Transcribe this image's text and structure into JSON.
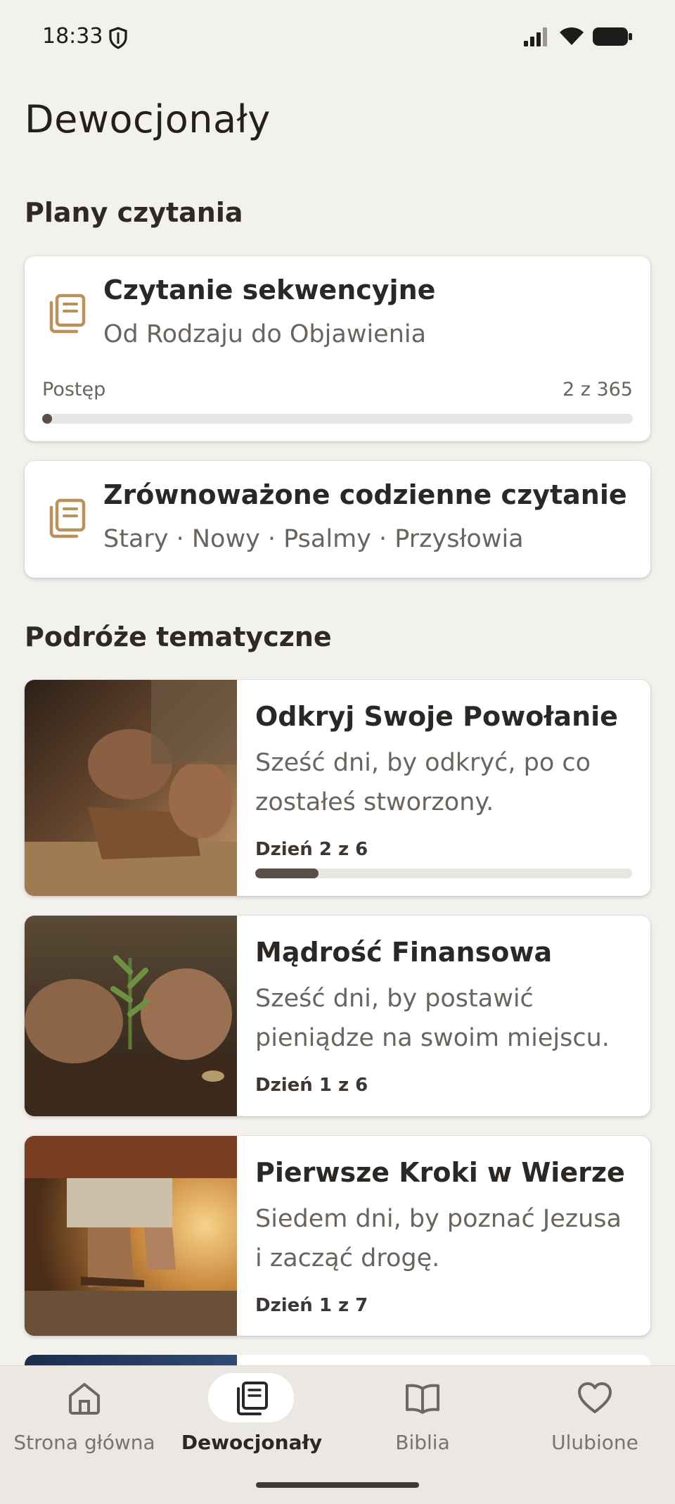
{
  "status_bar": {
    "time": "18:33"
  },
  "page_title": "Dewocjonały",
  "reading_plans": {
    "heading": "Plany czytania",
    "items": [
      {
        "title": "Czytanie sekwencyjne",
        "subtitle": "Od Rodzaju do Objawienia",
        "progress_label": "Postęp",
        "progress_count": "2 z 365",
        "progress_fraction": 0.0055,
        "icon": "books-icon"
      },
      {
        "title": "Zrównoważone codzienne czytanie",
        "subtitle": "Stary · Nowy · Psalmy · Przysłowia",
        "icon": "books-icon"
      }
    ]
  },
  "journeys": {
    "heading": "Podróże tematyczne",
    "items": [
      {
        "title": "Odkryj Swoje Powołanie",
        "description": "Sześć dni, by odkryć, po co zostałeś stworzony.",
        "day": "Dzień 2 z 6",
        "progress_fraction": 0.167,
        "image": "hands-carving-wood"
      },
      {
        "title": "Mądrość Finansowa",
        "description": "Sześć dni, by postawić pieniądze na swoim miejscu.",
        "day": "Dzień 1 z 6",
        "image": "hands-planting-seedling"
      },
      {
        "title": "Pierwsze Kroki w Wierze",
        "description": "Siedem dni, by poznać Jezusa i zacząć drogę.",
        "day": "Dzień 1 z 7",
        "image": "sandaled-feet-walking"
      }
    ]
  },
  "bottom_nav": {
    "items": [
      {
        "label": "Strona główna",
        "icon": "home-icon",
        "active": false
      },
      {
        "label": "Dewocjonały",
        "icon": "books-icon",
        "active": true
      },
      {
        "label": "Biblia",
        "icon": "open-book-icon",
        "active": false
      },
      {
        "label": "Ulubione",
        "icon": "heart-icon",
        "active": false
      }
    ]
  },
  "colors": {
    "background": "#f3f1ed",
    "accent_icon": "#b8925a",
    "progress_fill": "#5b4e46",
    "nav_background": "#ebe7e2"
  }
}
